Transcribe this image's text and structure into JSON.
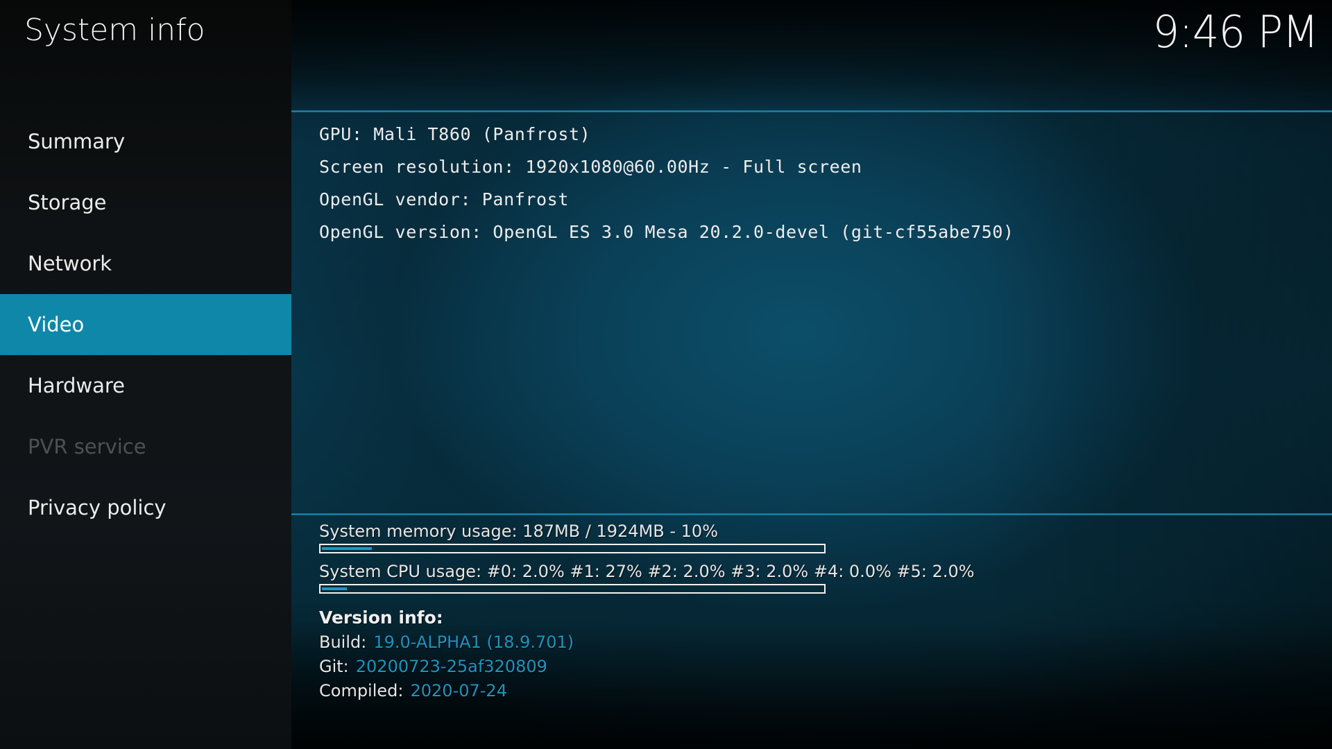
{
  "app": {
    "title": "System info",
    "clock": "9:46 PM"
  },
  "sidebar": {
    "items": [
      {
        "label": "Summary",
        "state": "normal"
      },
      {
        "label": "Storage",
        "state": "normal"
      },
      {
        "label": "Network",
        "state": "normal"
      },
      {
        "label": "Video",
        "state": "selected"
      },
      {
        "label": "Hardware",
        "state": "normal"
      },
      {
        "label": "PVR service",
        "state": "disabled"
      },
      {
        "label": "Privacy policy",
        "state": "normal"
      }
    ]
  },
  "video_info": {
    "lines": [
      "GPU: Mali T860 (Panfrost)",
      "Screen resolution: 1920x1080@60.00Hz - Full screen",
      "OpenGL vendor: Panfrost",
      "OpenGL version: OpenGL ES 3.0 Mesa 20.2.0-devel (git-cf55abe750)"
    ]
  },
  "usage": {
    "memory": {
      "label": "System memory usage: 187MB / 1924MB - 10%",
      "used_mb": 187,
      "total_mb": 1924,
      "percent": 10
    },
    "cpu": {
      "label": "System CPU usage: #0: 2.0% #1:  27% #2: 2.0% #3: 2.0% #4: 0.0% #5: 2.0%",
      "cores": [
        {
          "core": "#0",
          "percent": 2.0
        },
        {
          "core": "#1",
          "percent": 27
        },
        {
          "core": "#2",
          "percent": 2.0
        },
        {
          "core": "#3",
          "percent": 2.0
        },
        {
          "core": "#4",
          "percent": 0.0
        },
        {
          "core": "#5",
          "percent": 2.0
        }
      ],
      "bar_percent": 5
    }
  },
  "version_info": {
    "title": "Version info:",
    "rows": [
      {
        "key": "Build:",
        "value": "19.0-ALPHA1 (18.9.701)"
      },
      {
        "key": "Git:",
        "value": "20200723-25af320809"
      },
      {
        "key": "Compiled:",
        "value": "2020-07-24"
      }
    ]
  },
  "colors": {
    "accent": "#0f87a8",
    "progress_fill": "#1a9ac4",
    "version_value": "#1e93bd",
    "disabled_text": "#4d5154"
  }
}
